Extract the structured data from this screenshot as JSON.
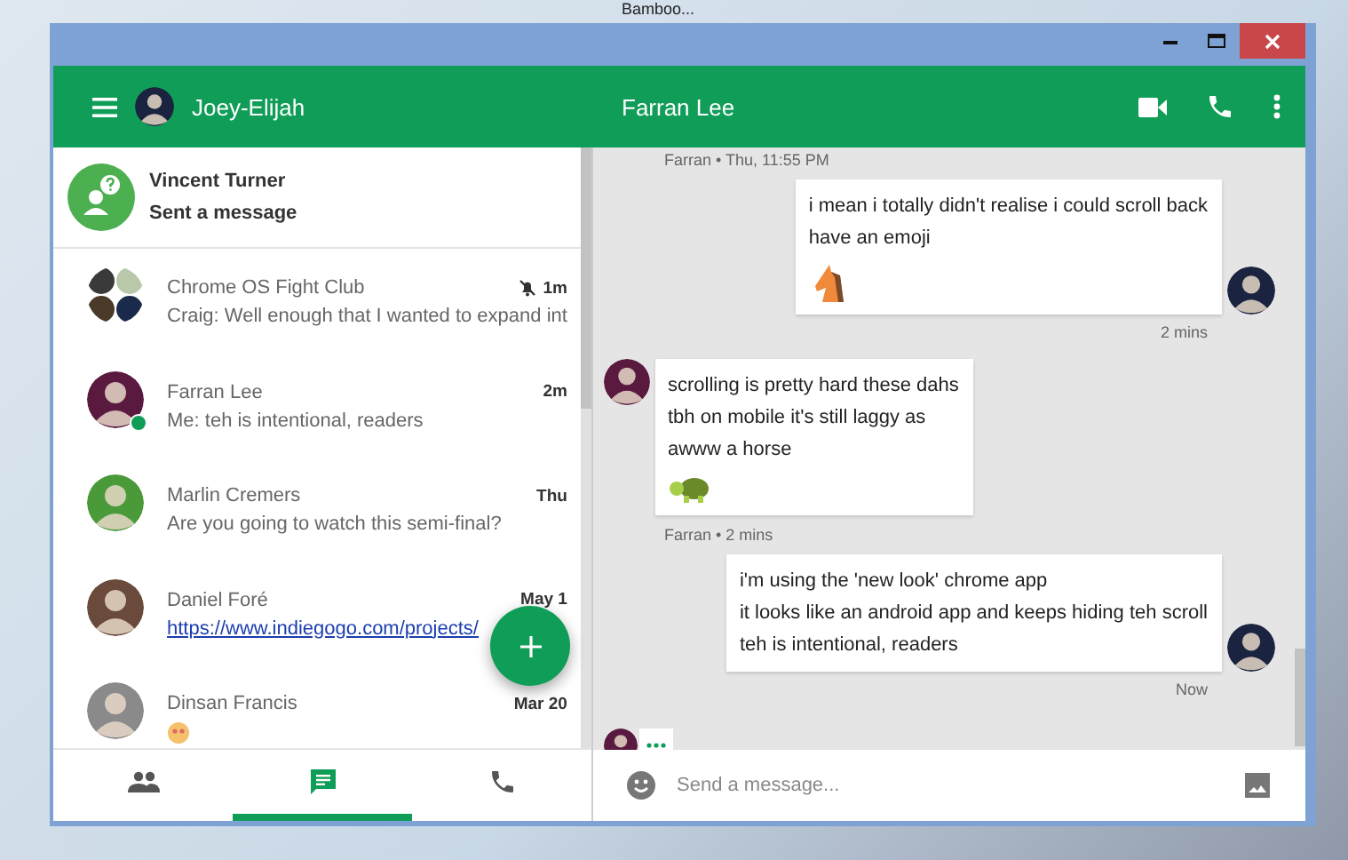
{
  "desktop": {
    "icon_label": "Bamboo..."
  },
  "header": {
    "user": "Joey-Elijah",
    "conversation_title": "Farran Lee"
  },
  "notification": {
    "name": "Vincent Turner",
    "text": "Sent a message"
  },
  "conversations": [
    {
      "kind": "group",
      "name": "Chrome OS Fight Club",
      "preview": {
        "kind": "text",
        "text": "Craig: Well enough that I wanted to expand int"
      },
      "time": "1m",
      "muted": true,
      "online": false
    },
    {
      "kind": "single",
      "name": "Farran Lee",
      "preview": {
        "kind": "text",
        "text": "Me: teh is intentional, readers"
      },
      "time": "2m",
      "muted": false,
      "online": true
    },
    {
      "kind": "single",
      "name": "Marlin Cremers",
      "preview": {
        "kind": "text",
        "text": "Are you going to watch this semi-final?"
      },
      "time": "Thu",
      "muted": false,
      "online": false
    },
    {
      "kind": "single",
      "name": "Daniel Foré",
      "preview": {
        "kind": "link",
        "text": "https://www.indiegogo.com/projects/"
      },
      "time": "May 1",
      "muted": false,
      "online": false
    },
    {
      "kind": "single",
      "name": "Dinsan Francis",
      "preview": {
        "kind": "emoji"
      },
      "time": "Mar 20",
      "muted": false,
      "online": false
    }
  ],
  "nav_tabs": [
    {
      "kind": "people",
      "selected": false
    },
    {
      "kind": "chat",
      "selected": true
    },
    {
      "kind": "phone",
      "selected": false
    }
  ],
  "messages": [
    {
      "kind": "meta",
      "text": "Farran • Thu, 11:55 PM"
    },
    {
      "kind": "outgoing",
      "lines": [
        "i mean i totally didn't realise i could scroll back",
        "have an emoji"
      ],
      "sticker": {
        "kind": "horse"
      }
    },
    {
      "kind": "stamp",
      "text": "2 mins"
    },
    {
      "kind": "incoming",
      "lines": [
        "scrolling is pretty hard these dahs",
        "tbh on mobile it's still laggy as",
        "awww a horse"
      ],
      "sticker": {
        "kind": "turtle"
      }
    },
    {
      "kind": "meta",
      "text": "Farran • 2 mins"
    },
    {
      "kind": "outgoing",
      "lines": [
        "i'm using the 'new look' chrome app",
        "it looks like an android app and keeps hiding teh scroll",
        "teh is intentional, readers"
      ]
    },
    {
      "kind": "stamp",
      "text": "Now"
    },
    {
      "kind": "typing"
    }
  ],
  "compose": {
    "placeholder": "Send a message..."
  }
}
